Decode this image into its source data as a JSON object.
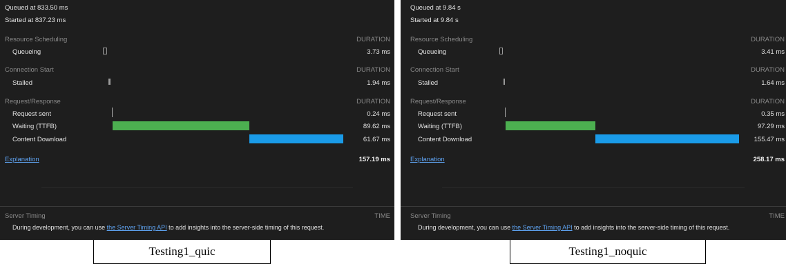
{
  "panels": [
    {
      "queued": "Queued at 833.50 ms",
      "started": "Started at 837.23 ms",
      "resource_scheduling": {
        "header": "Resource Scheduling",
        "duration_label": "DURATION",
        "queueing_label": "Queueing",
        "queueing_value": "3.73 ms"
      },
      "connection_start": {
        "header": "Connection Start",
        "duration_label": "DURATION",
        "stalled_label": "Stalled",
        "stalled_value": "1.94 ms"
      },
      "request_response": {
        "header": "Request/Response",
        "duration_label": "DURATION",
        "request_sent_label": "Request sent",
        "request_sent_value": "0.24 ms",
        "waiting_label": "Waiting (TTFB)",
        "waiting_value": "89.62 ms",
        "download_label": "Content Download",
        "download_value": "61.67 ms"
      },
      "explanation": "Explanation",
      "total": "157.19 ms",
      "server_timing": {
        "header": "Server Timing",
        "time_label": "TIME",
        "text_before": "During development, you can use ",
        "link": "the Server Timing API",
        "text_after": " to add insights into the server-side timing of this request."
      },
      "caption": "Testing1_quic"
    },
    {
      "queued": "Queued at 9.84 s",
      "started": "Started at 9.84 s",
      "resource_scheduling": {
        "header": "Resource Scheduling",
        "duration_label": "DURATION",
        "queueing_label": "Queueing",
        "queueing_value": "3.41 ms"
      },
      "connection_start": {
        "header": "Connection Start",
        "duration_label": "DURATION",
        "stalled_label": "Stalled",
        "stalled_value": "1.64 ms"
      },
      "request_response": {
        "header": "Request/Response",
        "duration_label": "DURATION",
        "request_sent_label": "Request sent",
        "request_sent_value": "0.35 ms",
        "waiting_label": "Waiting (TTFB)",
        "waiting_value": "97.29 ms",
        "download_label": "Content Download",
        "download_value": "155.47 ms"
      },
      "explanation": "Explanation",
      "total": "258.17 ms",
      "server_timing": {
        "header": "Server Timing",
        "time_label": "TIME",
        "text_before": "During development, you can use ",
        "link": "the Server Timing API",
        "text_after": " to add insights into the server-side timing of this request."
      },
      "caption": "Testing1_noquic"
    }
  ],
  "colors": {
    "waiting_bar": "#4caf50",
    "download_bar": "#1a9be8",
    "link": "#5ea2f0"
  }
}
